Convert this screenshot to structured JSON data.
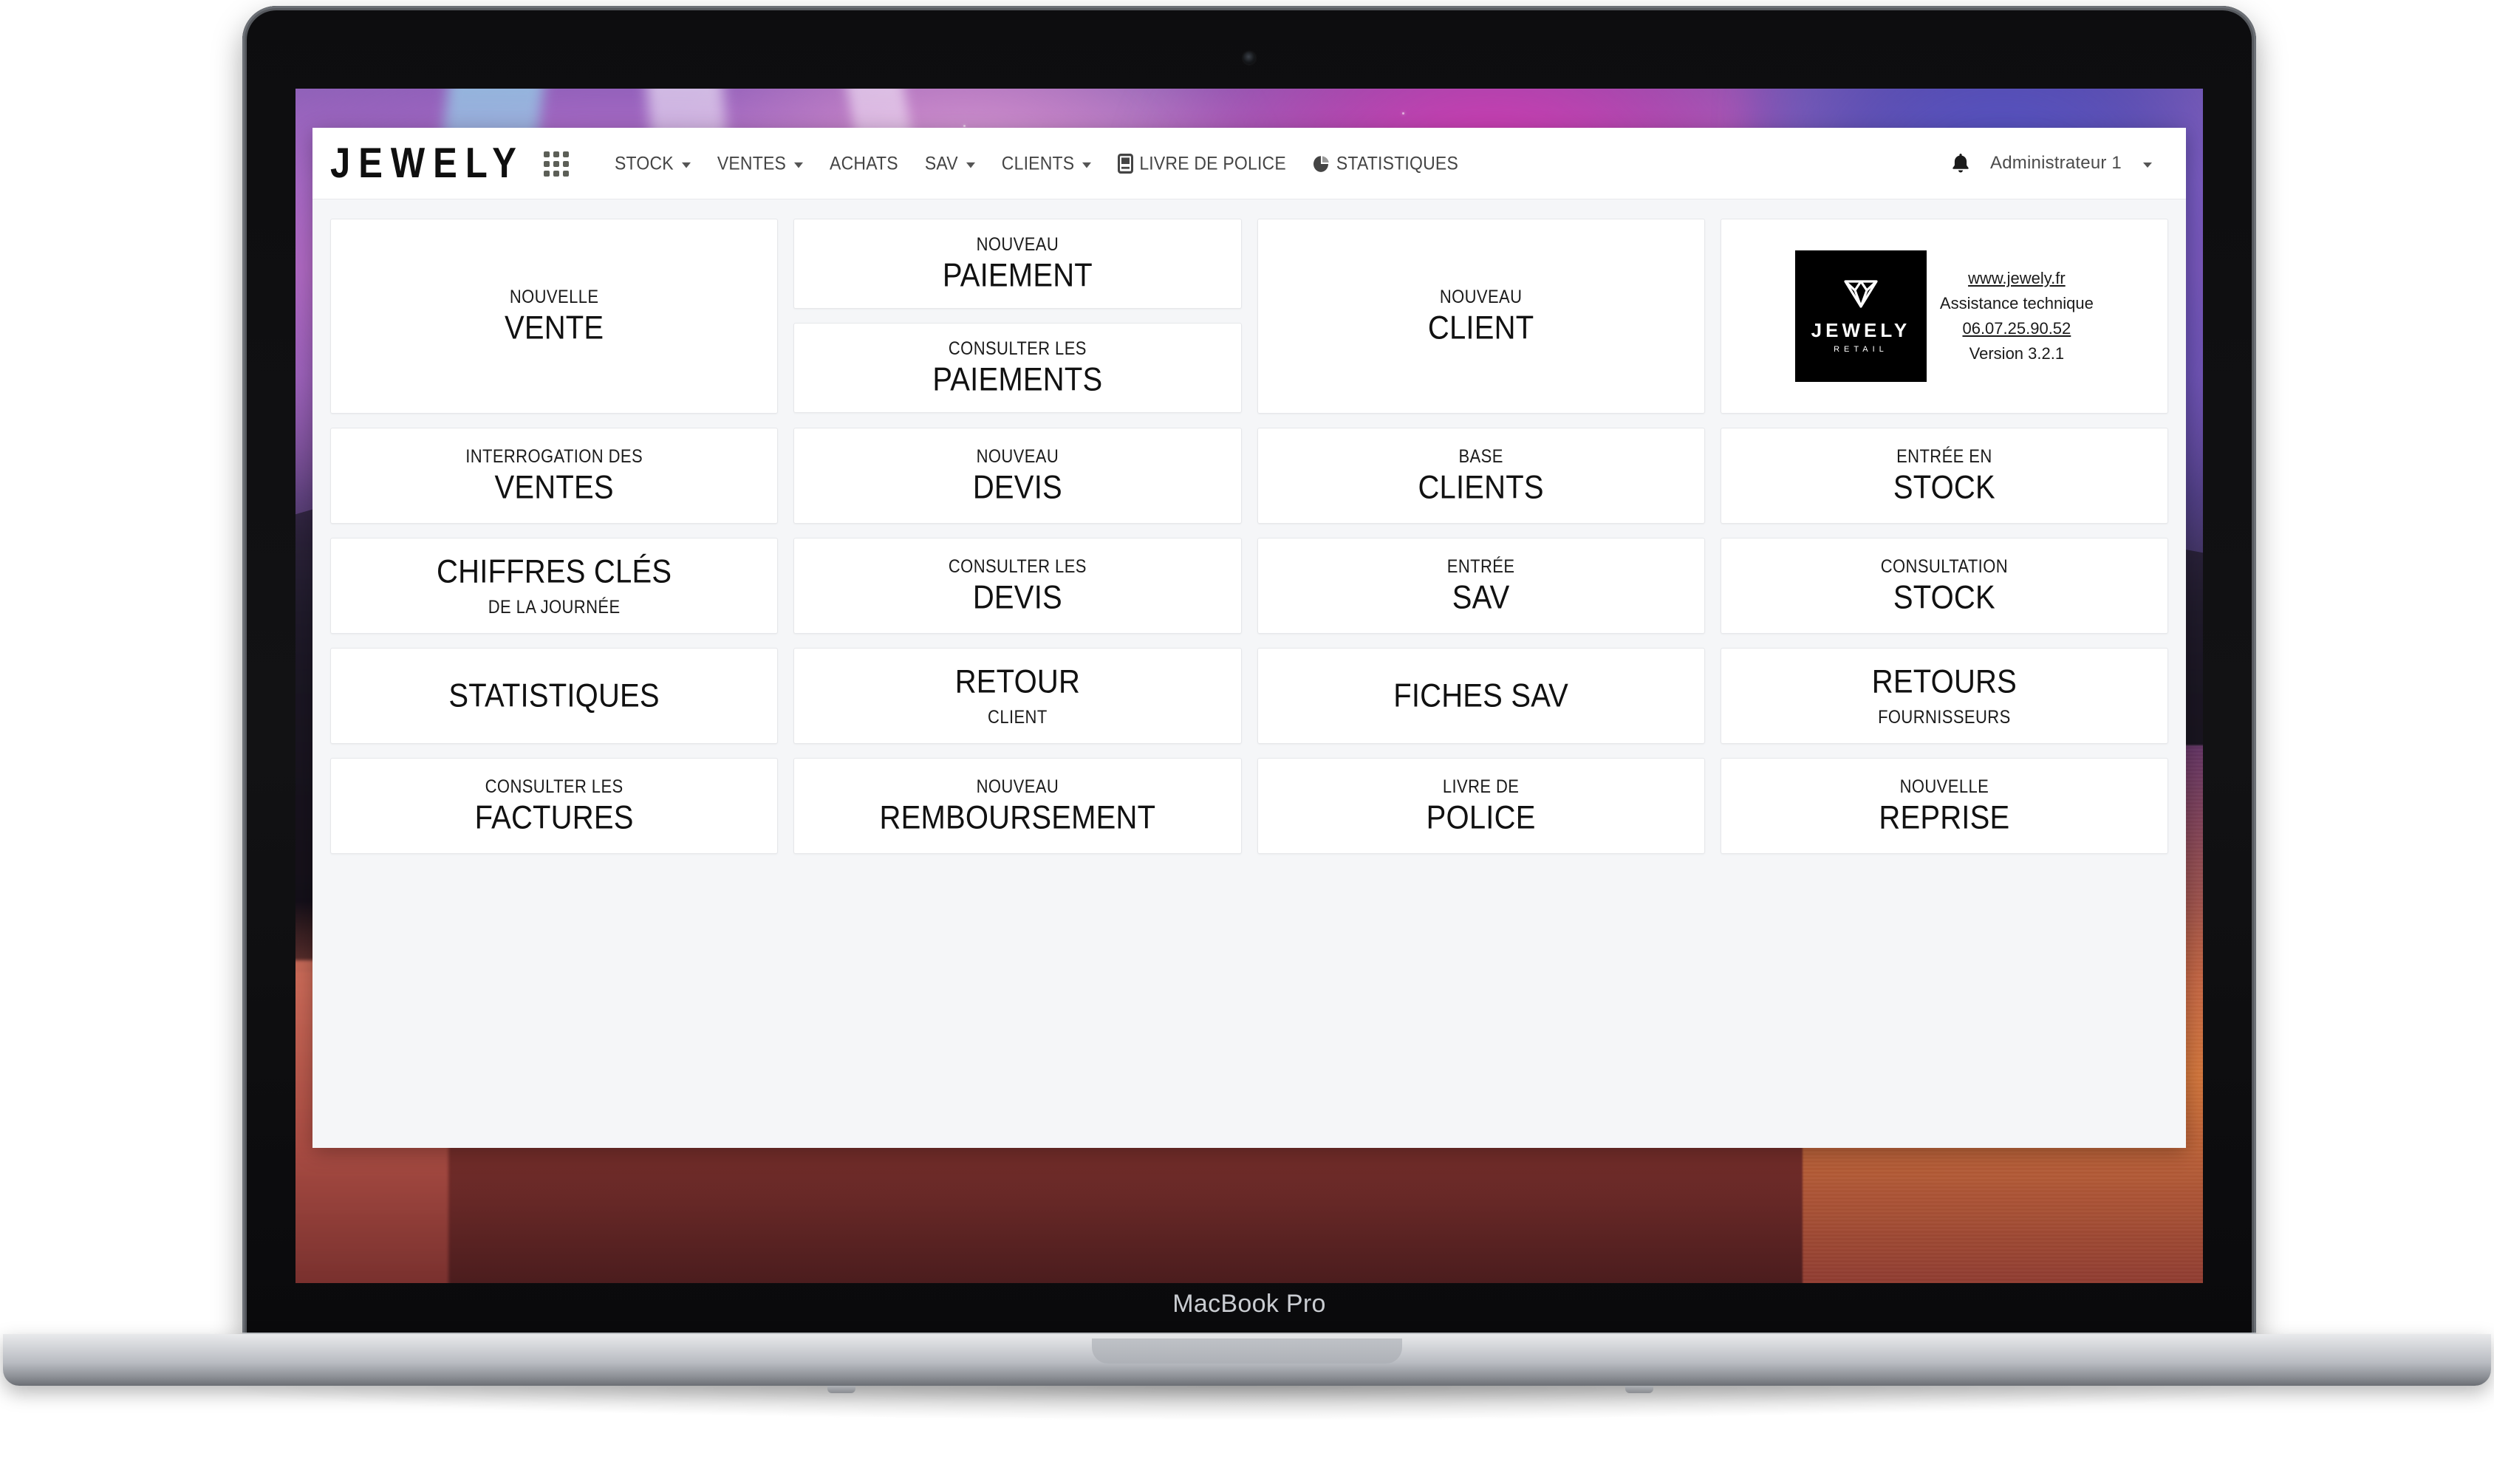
{
  "device": {
    "model_label": "MacBook Pro",
    "camera_icon": "camera-icon"
  },
  "navbar": {
    "brand": "JEWELY",
    "apps_grid_icon": "apps-grid-icon",
    "items": [
      {
        "label": "STOCK",
        "has_caret": true,
        "icon": null
      },
      {
        "label": "VENTES",
        "has_caret": true,
        "icon": null
      },
      {
        "label": "ACHATS",
        "has_caret": false,
        "icon": null
      },
      {
        "label": "SAV",
        "has_caret": true,
        "icon": null
      },
      {
        "label": "CLIENTS",
        "has_caret": true,
        "icon": null
      },
      {
        "label": "LIVRE DE POLICE",
        "has_caret": false,
        "icon": "book-icon"
      },
      {
        "label": "STATISTIQUES",
        "has_caret": false,
        "icon": "pie-chart-icon"
      }
    ],
    "notification_icon": "bell-icon",
    "user": {
      "name": "Administrateur 1",
      "has_caret": true
    }
  },
  "tiles": {
    "nouvelle_vente": {
      "small": "NOUVELLE",
      "big": "VENTE"
    },
    "nouveau_paiement": {
      "small": "NOUVEAU",
      "big": "PAIEMENT"
    },
    "consulter_paiements": {
      "small": "CONSULTER LES",
      "big": "PAIEMENTS"
    },
    "nouveau_client": {
      "small": "NOUVEAU",
      "big": "CLIENT"
    },
    "interrogation_ventes": {
      "small": "INTERROGATION DES",
      "big": "VENTES"
    },
    "nouveau_devis": {
      "small": "NOUVEAU",
      "big": "DEVIS"
    },
    "base_clients": {
      "small": "BASE",
      "big": "CLIENTS"
    },
    "entree_en_stock": {
      "small": "ENTRÉE EN",
      "big": "STOCK"
    },
    "chiffres_cles": {
      "big": "CHIFFRES CLÉS",
      "small": "DE LA JOURNÉE"
    },
    "consulter_devis": {
      "small": "CONSULTER LES",
      "big": "DEVIS"
    },
    "entree_sav": {
      "small": "ENTRÉE",
      "big": "SAV"
    },
    "consultation_stock": {
      "small": "CONSULTATION",
      "big": "STOCK"
    },
    "statistiques": {
      "small": "",
      "big": "STATISTIQUES"
    },
    "retour_client": {
      "big": "RETOUR",
      "small": "CLIENT"
    },
    "fiches_sav": {
      "small": "",
      "big": "FICHES SAV"
    },
    "retours_fournisseurs": {
      "big": "RETOURS",
      "small": "FOURNISSEURS"
    },
    "consulter_factures": {
      "small": "CONSULTER LES",
      "big": "FACTURES"
    },
    "nouveau_remboursement": {
      "small": "NOUVEAU",
      "big": "REMBOURSEMENT"
    },
    "livre_de_police": {
      "small": "LIVRE DE",
      "big": "POLICE"
    },
    "nouvelle_reprise": {
      "small": "NOUVELLE",
      "big": "REPRISE"
    }
  },
  "info_card": {
    "logo_icon": "diamond-icon",
    "logo_word": "JEWELY",
    "logo_sub": "RETAIL",
    "website": "www.jewely.fr",
    "support_label": "Assistance technique",
    "support_phone": "06.07.25.90.52",
    "version": "Version 3.2.1"
  },
  "colors": {
    "app_background": "#f5f6f8",
    "tile_background": "#ffffff",
    "tile_border": "#e6e7ea",
    "navbar_background": "#ffffff",
    "text_primary": "#111111",
    "nav_text": "#444444",
    "logo_box": "#000000"
  }
}
